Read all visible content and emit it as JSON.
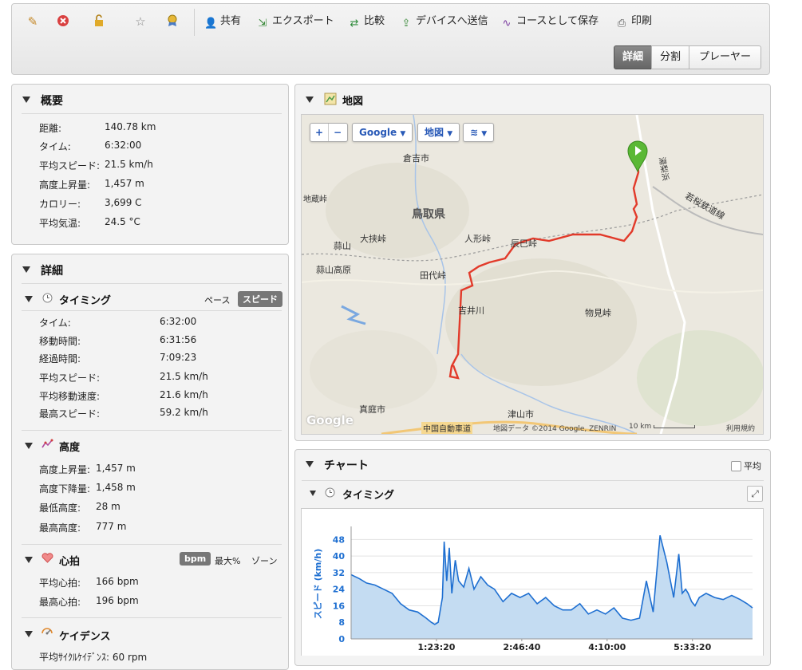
{
  "toolbar": {
    "actions": [
      {
        "icon": "share-icon",
        "label": "共有"
      },
      {
        "icon": "export-icon",
        "label": "エクスポート"
      },
      {
        "icon": "compare-icon",
        "label": "比較"
      },
      {
        "icon": "send-to-device-icon",
        "label": "デバイスへ送信"
      },
      {
        "icon": "save-course-icon",
        "label": "コースとして保存"
      },
      {
        "icon": "print-icon",
        "label": "印刷"
      }
    ],
    "view_buttons": [
      "詳細",
      "分割",
      "プレーヤー"
    ],
    "active_view": "詳細"
  },
  "summary": {
    "title": "概要",
    "rows": [
      {
        "label": "距離:",
        "value": "140.78 km"
      },
      {
        "label": "タイム:",
        "value": "6:32:00"
      },
      {
        "label": "平均スピード:",
        "value": "21.5 km/h"
      },
      {
        "label": "高度上昇量:",
        "value": "1,457 m"
      },
      {
        "label": "カロリー:",
        "value": "3,699 C"
      },
      {
        "label": "平均気温:",
        "value": "24.5 °C"
      }
    ]
  },
  "details": {
    "title": "詳細",
    "timing": {
      "title": "タイミング",
      "toggle": [
        "ペース",
        "スピード"
      ],
      "rows": [
        {
          "label": "タイム:",
          "value": "6:32:00"
        },
        {
          "label": "移動時間:",
          "value": "6:31:56"
        },
        {
          "label": "経過時間:",
          "value": "7:09:23"
        },
        {
          "label": "平均スピード:",
          "value": "21.5 km/h"
        },
        {
          "label": "平均移動速度:",
          "value": "21.6 km/h"
        },
        {
          "label": "最高スピード:",
          "value": "59.2 km/h"
        }
      ]
    },
    "elevation": {
      "title": "高度",
      "rows": [
        {
          "label": "高度上昇量:",
          "value": "1,457 m"
        },
        {
          "label": "高度下降量:",
          "value": "1,458 m"
        },
        {
          "label": "最低高度:",
          "value": "28 m"
        },
        {
          "label": "最高高度:",
          "value": "777 m"
        }
      ]
    },
    "heart_rate": {
      "title": "心拍",
      "toggle": [
        "bpm",
        "最大%",
        "ゾーン"
      ],
      "rows": [
        {
          "label": "平均心拍:",
          "value": "166 bpm"
        },
        {
          "label": "最高心拍:",
          "value": "196 bpm"
        }
      ]
    },
    "cadence": {
      "title": "ケイデンス",
      "partial_row": "平均ｻｲｸﾙｹｲﾃﾞﾝｽ: 60 rpm"
    }
  },
  "map": {
    "title": "地図",
    "controls": {
      "zoom_in": "+",
      "zoom_out": "−",
      "provider": "Google",
      "type": "地図"
    },
    "labels": [
      {
        "text": "倉吉市"
      },
      {
        "text": "鳥取県"
      },
      {
        "text": "若桜鉄道線"
      },
      {
        "text": "地蔵峠"
      },
      {
        "text": "蒜山"
      },
      {
        "text": "大挟峠"
      },
      {
        "text": "人形峠"
      },
      {
        "text": "辰巳峠"
      },
      {
        "text": "蒜山高原"
      },
      {
        "text": "田代峠"
      },
      {
        "text": "吉井川"
      },
      {
        "text": "物見峠"
      },
      {
        "text": "真庭市"
      },
      {
        "text": "津山市"
      },
      {
        "text": "中国自動車道"
      },
      {
        "text": "湯梨浜"
      }
    ],
    "attribution": "地図データ ©2014 Google, ZENRIN",
    "scale": "10 km",
    "terms": "利用規約",
    "logo": "Google"
  },
  "chart_panel": {
    "title": "チャート",
    "average_label": "平均",
    "sub_title": "タイミング"
  },
  "chart_data": {
    "type": "area",
    "ylabel": "スピード (km/h)",
    "yticks": [
      0,
      8,
      16,
      24,
      32,
      40,
      48
    ],
    "ylim": [
      0,
      52
    ],
    "xticks": [
      "1:23:20",
      "2:46:40",
      "4:10:00",
      "5:33:20"
    ],
    "xlim_seconds": [
      0,
      23520
    ],
    "x_seconds": [
      0,
      500,
      900,
      1400,
      1900,
      2400,
      2900,
      3400,
      3900,
      4400,
      4700,
      4900,
      5100,
      5350,
      5450,
      5600,
      5750,
      5900,
      6100,
      6300,
      6600,
      6900,
      7200,
      7600,
      8000,
      8400,
      8900,
      9400,
      9900,
      10400,
      10900,
      11400,
      11900,
      12400,
      12900,
      13400,
      13900,
      14400,
      14900,
      15400,
      15900,
      16400,
      16900,
      17300,
      17700,
      18100,
      18500,
      18900,
      19200,
      19400,
      19600,
      19750,
      19950,
      20150,
      20400,
      20800,
      21300,
      21800,
      22300,
      22800,
      23200,
      23520
    ],
    "values": [
      31,
      29,
      27,
      26,
      24,
      22,
      17,
      14,
      13,
      10,
      8,
      7,
      8,
      20,
      47,
      28,
      44,
      22,
      38,
      28,
      25,
      34,
      24,
      30,
      26,
      24,
      18,
      22,
      20,
      22,
      17,
      20,
      16,
      14,
      14,
      17,
      12,
      14,
      12,
      15,
      10,
      9,
      10,
      28,
      13,
      50,
      37,
      20,
      41,
      22,
      24,
      22,
      18,
      16,
      20,
      22,
      20,
      19,
      21,
      19,
      17,
      15
    ],
    "color": "#1e6fd1",
    "fill": "#c4dcf2"
  }
}
